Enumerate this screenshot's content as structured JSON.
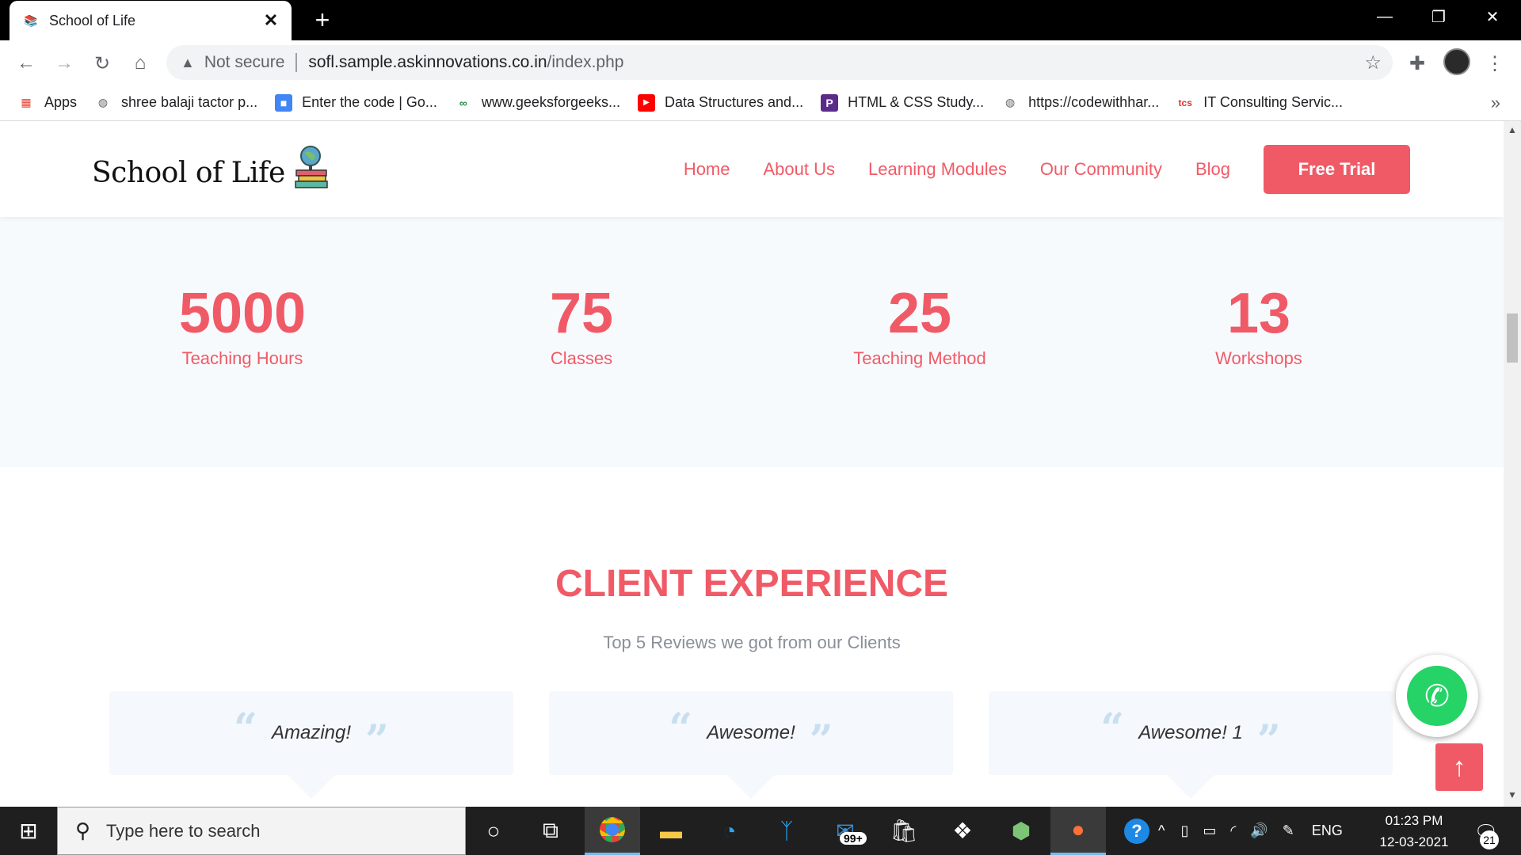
{
  "browser": {
    "tab_title": "School of Life",
    "new_tab_icon": "+",
    "omnibox": {
      "security_label": "Not secure",
      "url_host": "sofl.sample.askinnovations.co.in",
      "url_path": "/index.php"
    },
    "bookmarks": [
      {
        "label": "Apps",
        "icon": "apps-grid-icon",
        "color": "#ea4335"
      },
      {
        "label": "shree balaji tactor p...",
        "icon": "globe-icon",
        "color": "#5f6368"
      },
      {
        "label": "Enter the code | Go...",
        "icon": "google-classroom-icon",
        "color": "#4285f4"
      },
      {
        "label": "www.geeksforgeeks...",
        "icon": "geeksforgeeks-icon",
        "color": "#2f8d46"
      },
      {
        "label": "Data Structures and...",
        "icon": "youtube-icon",
        "color": "#ff0000"
      },
      {
        "label": "HTML & CSS Study...",
        "icon": "p-icon",
        "color": "#5b2b8a"
      },
      {
        "label": "https://codewithhar...",
        "icon": "globe-icon",
        "color": "#5f6368"
      },
      {
        "label": "IT Consulting Servic...",
        "icon": "tcs-icon",
        "color": "#e5322d"
      }
    ]
  },
  "site": {
    "logo_text": "School of Life",
    "nav": [
      "Home",
      "About Us",
      "Learning Modules",
      "Our Community",
      "Blog"
    ],
    "cta_label": "Free Trial",
    "accent_color": "#f05a66",
    "stats": [
      {
        "value": "5000",
        "label": "Teaching Hours"
      },
      {
        "value": "75",
        "label": "Classes"
      },
      {
        "value": "25",
        "label": "Teaching Method"
      },
      {
        "value": "13",
        "label": "Workshops"
      }
    ],
    "client_section": {
      "title": "CLIENT EXPERIENCE",
      "subtitle": "Top 5 Reviews we got from our Clients",
      "reviews": [
        "Amazing!",
        "Awesome!",
        "Awesome! 1"
      ]
    }
  },
  "taskbar": {
    "search_placeholder": "Type here to search",
    "mail_badge": "99+",
    "language": "ENG",
    "time": "01:23 PM",
    "date": "12-03-2021",
    "notification_count": "21"
  }
}
